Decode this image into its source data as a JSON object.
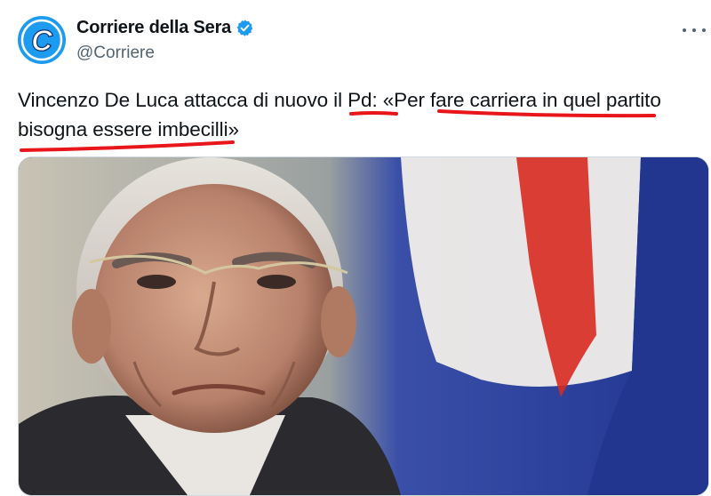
{
  "author": {
    "display_name": "Corriere della Sera",
    "handle": "@Corriere",
    "verified": true,
    "avatar_icon": "corriere-c-logo-icon",
    "verified_icon": "verified-badge-icon",
    "brand_color": "#1d9bf0"
  },
  "menu": {
    "icon": "more-horizontal-icon"
  },
  "tweet": {
    "text": "Vincenzo De Luca attacca di nuovo il Pd: «Per fare carriera in quel partito\nbisogna essere imbecilli»",
    "annotation_color": "#e8161b"
  },
  "media": {
    "icon": "photo-portrait-icon",
    "subject_colors": {
      "flag_blue": "#2a3f9a",
      "flag_white": "#f1eee9",
      "flag_red": "#d82a20"
    }
  }
}
